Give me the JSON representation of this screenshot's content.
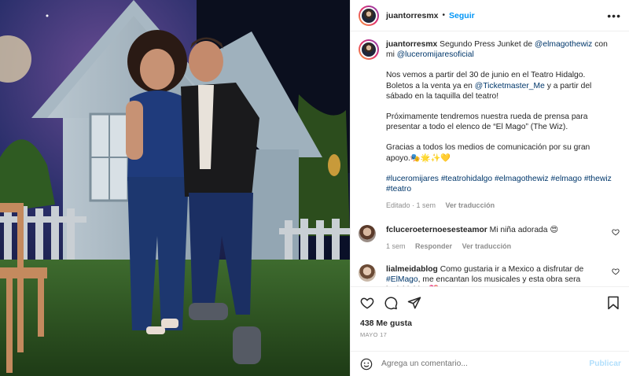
{
  "post": {
    "author": "juantorresmx",
    "follow_label": "Seguir",
    "more_label": "•••"
  },
  "caption": {
    "author": "juantorresmx",
    "line1_text": "Segundo Press Junket de ",
    "mention1": "@elmagothewiz",
    "line1_tail": " con mi ",
    "mention2": "@luceromijaresoficial",
    "p2_a": "Nos vemos a partir del 30 de junio en el Teatro Hidalgo. Boletos a la venta ya en ",
    "mention3": "@Ticketmaster_Me",
    "p2_b": " y a partir del sábado en la taquilla del teatro!",
    "p3": "Próximamente tendremos nuestra rueda de prensa para presentar a todo el elenco de “El Mago” (The Wiz).",
    "p4": "Gracias a todos los medios de comunicación por su gran apoyo.🎭🌟✨💛",
    "hashtags": "#luceromijares #teatrohidalgo #elmagothewiz #elmago #thewiz #teatro",
    "edited": "Editado · 1 sem",
    "translate": "Ver traducción"
  },
  "comments": [
    {
      "user": "fcluceroeternoesesteamor",
      "text": "Mi niña adorada 😍",
      "time": "1 sem",
      "reply": "Responder",
      "translate": "Ver traducción"
    },
    {
      "user": "lialmeidablog",
      "text_a": "Como gustaria ir a Mexico a disfrutar de ",
      "hashtag": "#ElMago",
      "text_b": ", me encantan los musicales y esta obra sera inolvidable. 💖"
    }
  ],
  "footer": {
    "likes": "438 Me gusta",
    "date": "MAYO 17",
    "comment_placeholder": "Agrega un comentario...",
    "publish_label": "Publicar"
  },
  "icons": {
    "like": "heart-icon",
    "comment": "comment-icon",
    "share": "share-icon",
    "save": "bookmark-icon",
    "emoji": "emoji-icon"
  }
}
